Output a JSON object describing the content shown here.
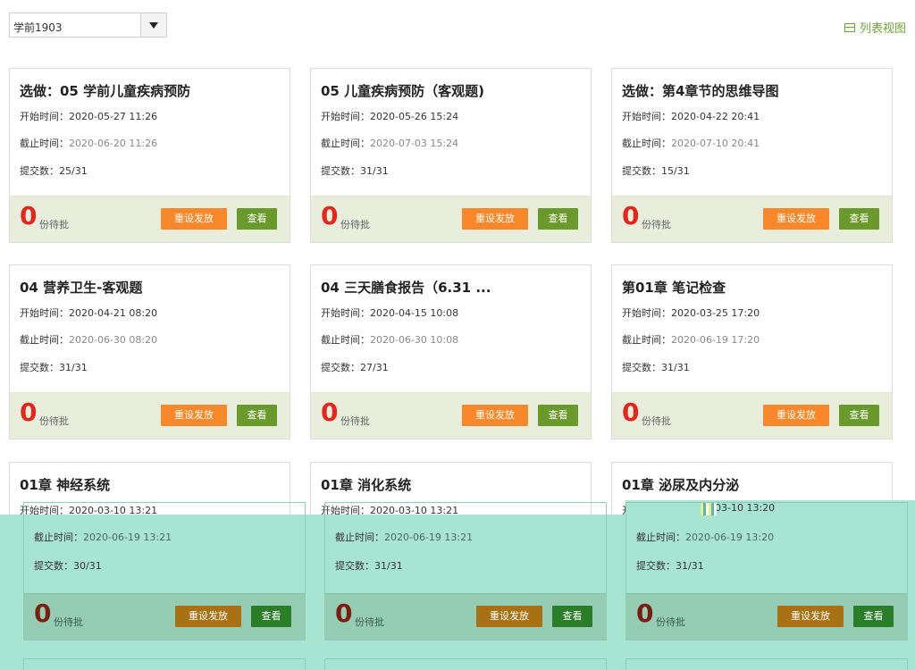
{
  "class_select": {
    "value": "学前1903"
  },
  "list_view_label": "列表视图",
  "labels": {
    "start": "开始时间：",
    "deadline": "截止时间：",
    "submissions": "提交数：",
    "pending": "份待批",
    "reset": "重设发放",
    "view": "查看"
  },
  "cards": [
    {
      "title": "选做：05 学前儿童疾病预防",
      "start": "2020-05-27 11:26",
      "deadline": "2020-06-20 11:26",
      "submissions": "25/31",
      "pending_count": "0"
    },
    {
      "title": "05 儿童疾病预防（客观题)",
      "start": "2020-05-26 15:24",
      "deadline": "2020-07-03 15:24",
      "submissions": "31/31",
      "pending_count": "0"
    },
    {
      "title": "选做：第4章节的思维导图",
      "start": "2020-04-22 20:41",
      "deadline": "2020-07-10 20:41",
      "submissions": "15/31",
      "pending_count": "0"
    },
    {
      "title": "04 营养卫生-客观题",
      "start": "2020-04-21 08:20",
      "deadline": "2020-06-30 08:20",
      "submissions": "31/31",
      "pending_count": "0"
    },
    {
      "title": "04 三天膳食报告（6.31 ...",
      "start": "2020-04-15 10:08",
      "deadline": "2020-06-30 10:08",
      "submissions": "27/31",
      "pending_count": "0"
    },
    {
      "title": "第01章 笔记检查",
      "start": "2020-03-25 17:20",
      "deadline": "2020-06-19 17:20",
      "submissions": "31/31",
      "pending_count": "0"
    },
    {
      "title": "01章 神经系统",
      "start": "2020-03-10 13:21",
      "deadline": "2020-06-19 13:21",
      "submissions": "30/31",
      "pending_count": "0"
    },
    {
      "title": "01章 消化系统",
      "start": "2020-03-10 13:21",
      "deadline": "2020-06-19 13:21",
      "submissions": "31/31",
      "pending_count": "0"
    },
    {
      "title": "01章 泌尿及内分泌",
      "start": "2020-03-10 13:20",
      "deadline": "2020-06-19 13:20",
      "submissions": "31/31",
      "pending_count": "0"
    }
  ],
  "partial_start_third": {
    "prefix": "202",
    "suffix": "03-10 13:20"
  }
}
